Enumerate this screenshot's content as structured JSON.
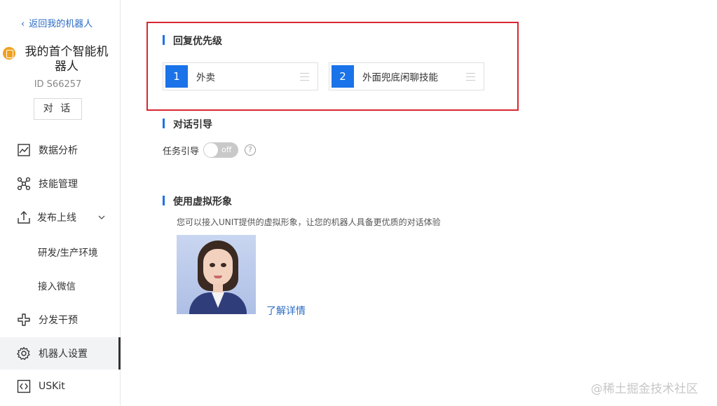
{
  "sidebar": {
    "back_label": "返回我的机器人",
    "bot_name": "我的首个智能机器人",
    "bot_id": "ID S66257",
    "chat_button": "对 话",
    "items": [
      {
        "label": "数据分析"
      },
      {
        "label": "技能管理"
      },
      {
        "label": "发布上线"
      },
      {
        "label": "研发/生产环境"
      },
      {
        "label": "接入微信"
      },
      {
        "label": "分发干预"
      },
      {
        "label": "机器人设置"
      },
      {
        "label": "USKit"
      }
    ],
    "active_item": "机器人设置"
  },
  "main": {
    "reply_priority": {
      "title": "回复优先级",
      "skills": [
        {
          "number": "1",
          "name": "外卖"
        },
        {
          "number": "2",
          "name": "外面兜底闲聊技能"
        }
      ]
    },
    "dialog_guide": {
      "title": "对话引导",
      "task_label": "任务引导",
      "toggle_state": "off",
      "help_symbol": "?"
    },
    "virtual_avatar": {
      "title": "使用虚拟形象",
      "description": "您可以接入UNIT提供的虚拟形象，让您的机器人具备更优质的对话体验",
      "learn_more": "了解详情"
    }
  },
  "watermark": "@稀土掘金技术社区",
  "colors": {
    "accent": "#1a73e8",
    "link": "#2b6cc4",
    "highlight_box": "#d8262f",
    "avatar_badge": "#f0a020"
  }
}
